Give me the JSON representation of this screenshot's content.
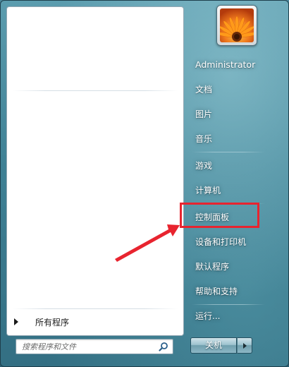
{
  "start_menu": {
    "all_programs_label": "所有程序",
    "search_placeholder": "搜索程序和文件",
    "user": {
      "name": "Administrator"
    },
    "right_items": [
      {
        "id": "documents",
        "label": "文档"
      },
      {
        "id": "pictures",
        "label": "图片"
      },
      {
        "id": "music",
        "label": "音乐"
      },
      {
        "id": "games",
        "label": "游戏"
      },
      {
        "id": "computer",
        "label": "计算机"
      },
      {
        "id": "control-panel",
        "label": "控制面板"
      },
      {
        "id": "devices-printers",
        "label": "设备和打印机"
      },
      {
        "id": "default-programs",
        "label": "默认程序"
      },
      {
        "id": "help-support",
        "label": "帮助和支持"
      },
      {
        "id": "run",
        "label": "运行..."
      }
    ],
    "shutdown_label": "关机",
    "annotation": {
      "highlight_color": "#e8242f",
      "highlighted_item": "control-panel"
    }
  }
}
